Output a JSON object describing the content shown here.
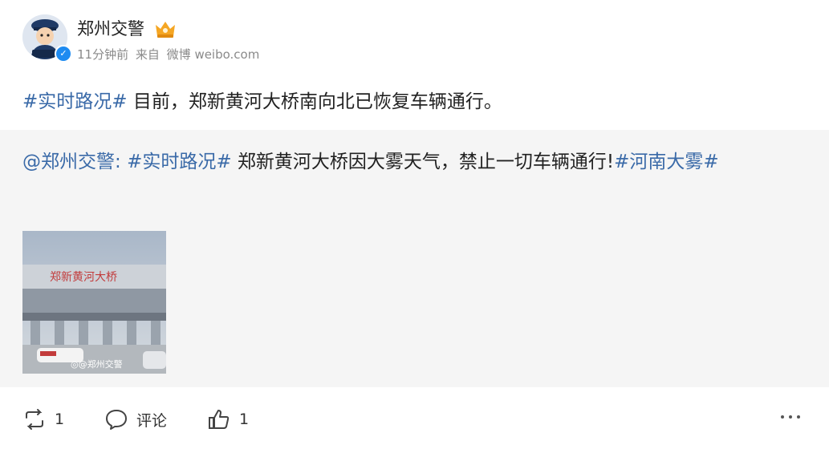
{
  "post": {
    "author": "郑州交警",
    "meta": {
      "time": "11分钟前",
      "source_prefix": "来自",
      "source": "微博 weibo.com"
    },
    "text": {
      "topic": "#实时路况#",
      "body": " 目前，郑新黄河大桥南向北已恢复车辆通行。"
    }
  },
  "repost": {
    "mention": "@郑州交警",
    "colon": ": ",
    "topic1": "#实时路况#",
    "body": " 郑新黄河大桥因大雾天气，禁止一切车辆通行!",
    "topic2": "#河南大雾#",
    "image": {
      "watermark": "@郑州交警",
      "sign_text": "郑新黄河大桥"
    }
  },
  "actions": {
    "repost_count": "1",
    "comment_label": "评论",
    "like_count": "1"
  },
  "colors": {
    "link": "#3a6aa8",
    "repost_bg": "#f5f5f5",
    "verify": "#1e8bf1"
  }
}
